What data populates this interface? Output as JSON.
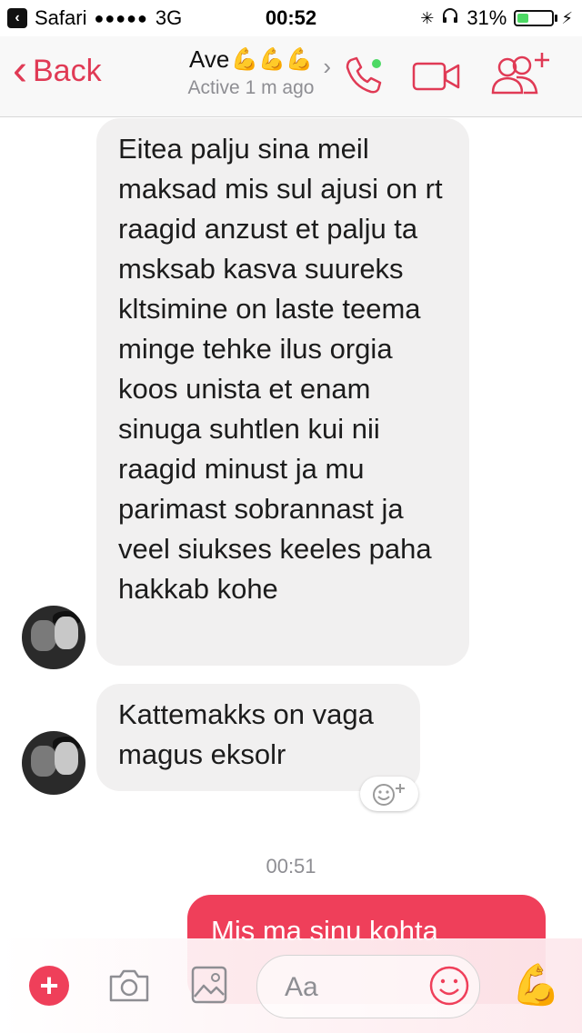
{
  "status_bar": {
    "back_app": "Safari",
    "signal": "●●●●●",
    "network": "3G",
    "time": "00:52",
    "battery_percent": "31%",
    "battery_level": 0.31
  },
  "nav": {
    "back_label": "Back",
    "contact_name": "Ave",
    "contact_name_emoji": "💪💪💪",
    "contact_status": "Active 1 m ago",
    "accent_color": "#e03a55",
    "icons": [
      "phone-icon",
      "video-icon",
      "add-people-icon"
    ]
  },
  "messages": [
    {
      "direction": "incoming",
      "text": "Eitea palju sina meil maksad mis sul ajusi on rt raagid anzust et palju ta msksab kasva suureks kltsimine on laste teema minge tehke ilus orgia koos unista et enam sinuga suhtlen kui nii raagid minust ja mu parimast sobrannast ja veel siukses keeles paha hakkab kohe"
    },
    {
      "direction": "incoming",
      "text": "Kattemakks on vaga magus eksolr"
    }
  ],
  "timestamp": "00:51",
  "outgoing_message": "Mis ma sinu kohta",
  "composer": {
    "placeholder": "Aa",
    "bubble_out_color": "#ef3f5a",
    "icons": [
      "plus-icon",
      "camera-icon",
      "image-icon",
      "emoji-icon",
      "flexed-biceps-icon"
    ]
  }
}
